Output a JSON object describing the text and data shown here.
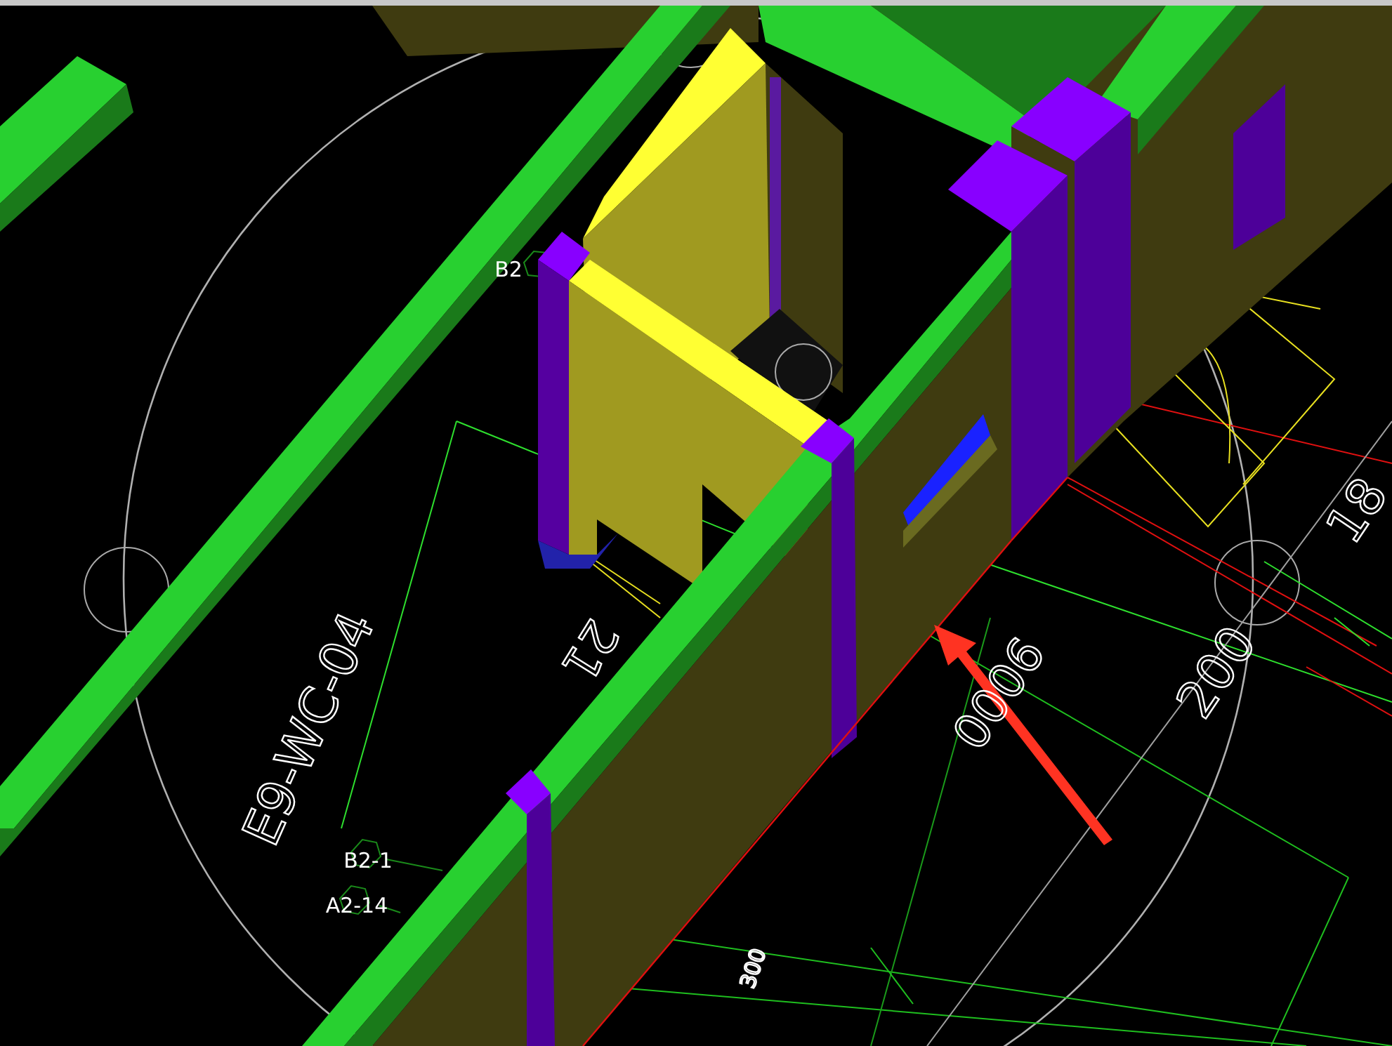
{
  "viewport": {
    "labels": [
      {
        "text": "B2",
        "kind": "tag"
      },
      {
        "text": "E9-WC-04",
        "kind": "room"
      },
      {
        "text": "21",
        "kind": "dimension"
      },
      {
        "text": "9000",
        "kind": "dimension"
      },
      {
        "text": "200",
        "kind": "dimension"
      },
      {
        "text": "18",
        "kind": "dimension"
      },
      {
        "text": "B2-1",
        "kind": "tag"
      },
      {
        "text": "A2-14",
        "kind": "tag"
      },
      {
        "text": "300",
        "kind": "dimension"
      }
    ]
  }
}
